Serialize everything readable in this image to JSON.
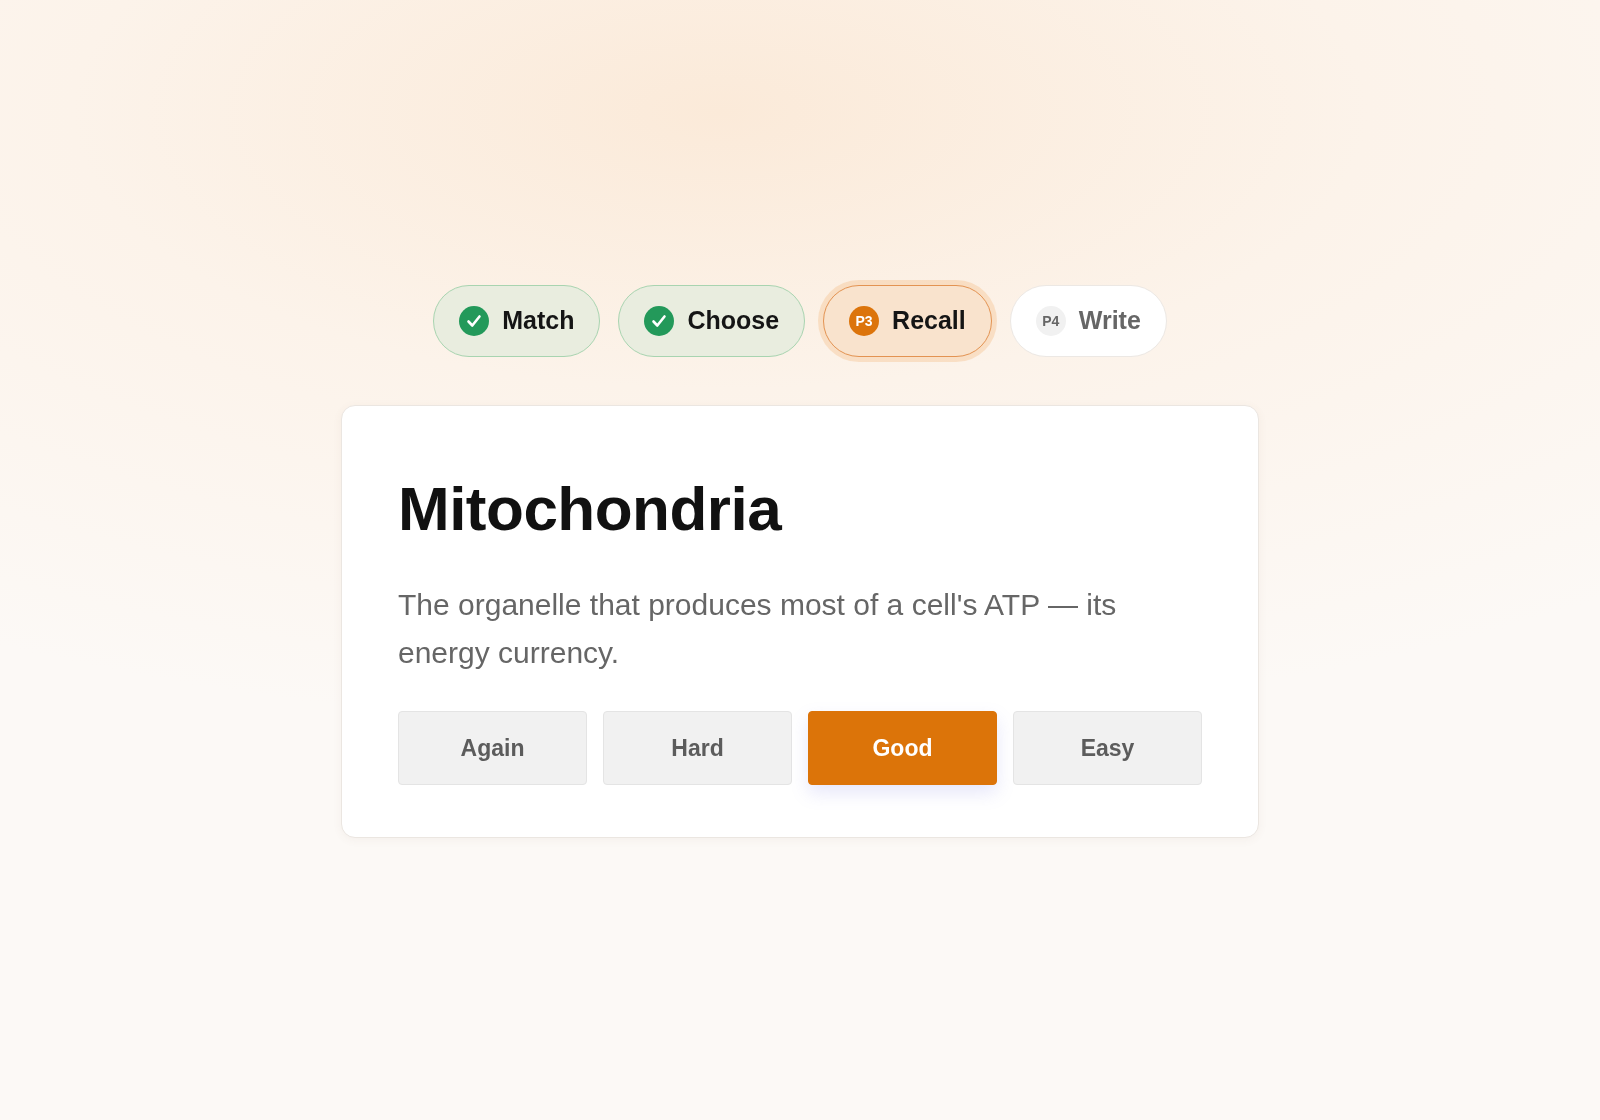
{
  "steps": [
    {
      "label": "Match",
      "completed": true,
      "selected": false
    },
    {
      "label": "Choose",
      "completed": true,
      "selected": false
    },
    {
      "label": "Recall",
      "completed": false,
      "selected": true,
      "badge": "P3"
    },
    {
      "label": "Write",
      "completed": false,
      "selected": false,
      "badge": "P4"
    }
  ],
  "card": {
    "term": "Mitochondria",
    "definition": "The organelle that produces most of a cell's ATP — its energy currency."
  },
  "ratings": [
    {
      "label": "Again",
      "selected": false
    },
    {
      "label": "Hard",
      "selected": false
    },
    {
      "label": "Good",
      "selected": true
    },
    {
      "label": "Easy",
      "selected": false
    }
  ]
}
